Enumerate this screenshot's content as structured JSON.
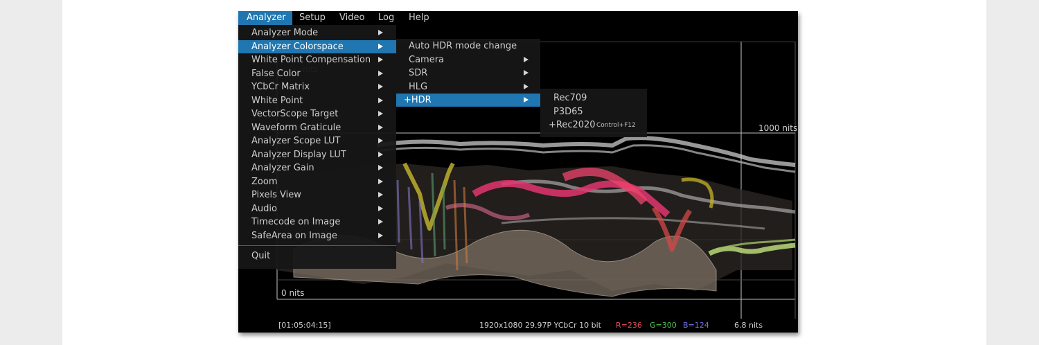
{
  "menubar": {
    "items": [
      "Analyzer",
      "Setup",
      "Video",
      "Log",
      "Help"
    ],
    "active": "Analyzer"
  },
  "analyzer_menu": {
    "items": [
      {
        "label": "Analyzer Mode",
        "submenu": true
      },
      {
        "label": "Analyzer Colorspace",
        "submenu": true,
        "highlighted": true
      },
      {
        "label": "White Point Compensation",
        "submenu": true
      },
      {
        "label": "False Color",
        "submenu": true
      },
      {
        "label": "YCbCr Matrix",
        "submenu": true
      },
      {
        "label": "White Point",
        "submenu": true
      },
      {
        "label": "VectorScope Target",
        "submenu": true
      },
      {
        "label": "Waveform Graticule",
        "submenu": true
      },
      {
        "label": "Analyzer Scope LUT",
        "submenu": true
      },
      {
        "label": "Analyzer Display LUT",
        "submenu": true
      },
      {
        "label": "Analyzer Gain",
        "submenu": true
      },
      {
        "label": "Zoom",
        "submenu": true
      },
      {
        "label": "Pixels View",
        "submenu": true
      },
      {
        "label": "Audio",
        "submenu": true
      },
      {
        "label": "Timecode on Image",
        "submenu": true
      },
      {
        "label": "SafeArea on Image",
        "submenu": true
      }
    ],
    "quit": "Quit"
  },
  "colorspace_menu": {
    "items": [
      {
        "label": "Auto HDR mode change",
        "submenu": false
      },
      {
        "label": "Camera",
        "submenu": true
      },
      {
        "label": "SDR",
        "submenu": true
      },
      {
        "label": "HLG",
        "submenu": true
      },
      {
        "label": "+HDR",
        "submenu": true,
        "highlighted": true
      }
    ]
  },
  "hdr_menu": {
    "items": [
      {
        "label": "Rec709",
        "shortcut": ""
      },
      {
        "label": "P3D65",
        "shortcut": ""
      },
      {
        "label": "+Rec2020",
        "shortcut": "Control+F12"
      }
    ]
  },
  "scope": {
    "top_label": "1000 nits",
    "bottom_label": "0 nits",
    "partial_label": "nits"
  },
  "status": {
    "timecode": "[01:05:04:15]",
    "format": "1920x1080 29.97P YCbCr 10 bit",
    "r": "R=236",
    "g": "G=300",
    "b": "B=124",
    "nits": "6.8 nits"
  },
  "colors": {
    "menu_highlight": "#1f76b0",
    "r_value": "#e0505a",
    "g_value": "#4fc24f",
    "b_value": "#7870e8",
    "waveform_white": "#d8d8d8",
    "waveform_magenta": "#e0356e",
    "waveform_yellow": "#c8b830",
    "waveform_green": "#b8d878"
  }
}
